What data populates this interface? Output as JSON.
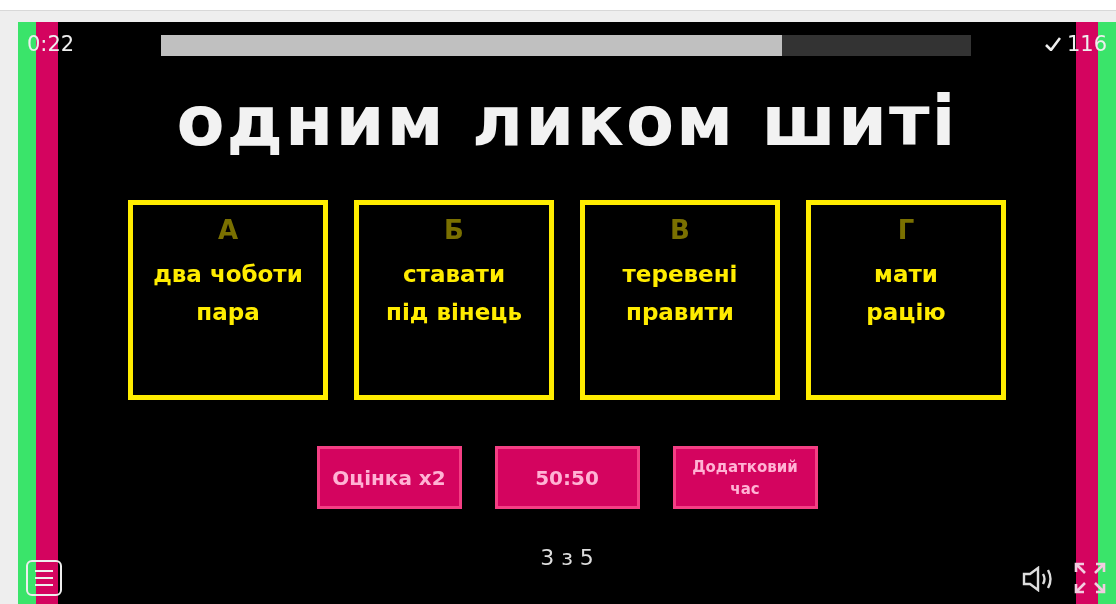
{
  "timer": "0:22",
  "progress": {
    "level": 0.767
  },
  "score": "116",
  "question": "одним ликом шиті",
  "answers": [
    {
      "letter": "А",
      "text": "два чоботи\nпара"
    },
    {
      "letter": "Б",
      "text": "ставати\nпід вінець"
    },
    {
      "letter": "В",
      "text": "теревені\nправити"
    },
    {
      "letter": "Г",
      "text": "мати\nрацію"
    }
  ],
  "lifelines": [
    "Оцінка x2",
    "50:50",
    "Додатковий\nчас"
  ],
  "pager": "3 з 5"
}
